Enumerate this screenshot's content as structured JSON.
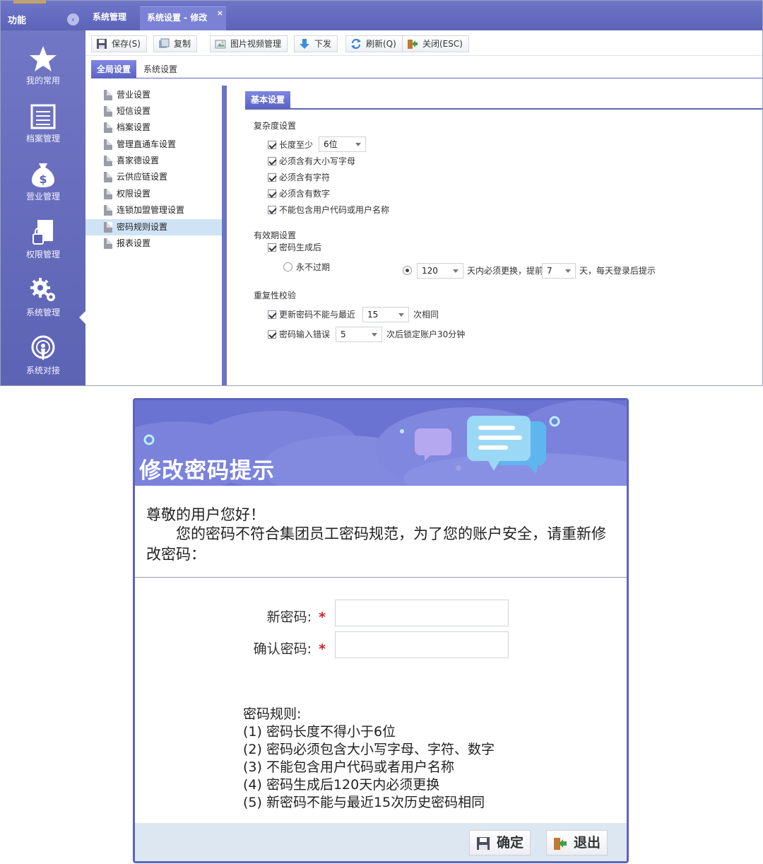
{
  "app": {
    "function_label": "功能",
    "tabs": [
      {
        "label": "系统管理"
      },
      {
        "label": "系统设置 - 修改"
      }
    ],
    "tab_close": "×",
    "nav": [
      {
        "label": "我的常用",
        "icon": "star-icon"
      },
      {
        "label": "档案管理",
        "icon": "file-list-icon"
      },
      {
        "label": "营业管理",
        "icon": "money-bag-icon"
      },
      {
        "label": "权限管理",
        "icon": "lock-document-icon"
      },
      {
        "label": "系统管理",
        "icon": "gears-icon"
      },
      {
        "label": "系统对接",
        "icon": "connection-icon"
      }
    ],
    "toolbar": [
      {
        "label": "保存(S)",
        "icon": "save-icon"
      },
      {
        "label": "复制",
        "icon": "copy-icon"
      },
      {
        "label": "图片视频管理",
        "icon": "media-icon"
      },
      {
        "label": "下发",
        "icon": "download-arrow-icon"
      },
      {
        "label": "刷新(Q)",
        "icon": "refresh-icon"
      },
      {
        "label": "关闭(ESC)",
        "icon": "exit-icon"
      }
    ],
    "subtabs": {
      "active": "全局设置",
      "other": "系统设置"
    },
    "tree": [
      "营业设置",
      "短信设置",
      "档案设置",
      "管理直通车设置",
      "喜家德设置",
      "云供应链设置",
      "权限设置",
      "连锁加盟管理设置",
      "密码规则设置",
      "报表设置"
    ],
    "tree_selected_index": 8,
    "section_title": "基本设置",
    "complexity": {
      "title": "复杂度设置",
      "min_length_label": "长度至少",
      "min_length_value": "6位",
      "items": [
        "必须含有大小写字母",
        "必须含有字符",
        "必须含有数字",
        "不能包含用户代码或用户名称"
      ]
    },
    "validity": {
      "title": "有效期设置",
      "after_generation_label": "密码生成后",
      "never_expire_label": "永不过期",
      "days_value": "120",
      "days_text": "天内必须更换，提前",
      "advance_value": "7",
      "advance_text": "天，每天登录后提示"
    },
    "repeat": {
      "title": "重复性校验",
      "history_label": "更新密码不能与最近",
      "history_value": "15",
      "history_suffix": "次相同",
      "lock_label": "密码输入错误",
      "lock_value": "5",
      "lock_suffix": "次后锁定账户30分钟"
    }
  },
  "dialog": {
    "title": "修改密码提示",
    "greeting": "尊敬的用户您好！",
    "message": "您的密码不符合集团员工密码规范，为了您的账户安全，请重新修改密码：",
    "new_password_label": "新密码:",
    "confirm_password_label": "确认密码:",
    "required_mark": "*",
    "rules_title": "密码规则:",
    "rules": [
      "(1) 密码长度不得小于6位",
      "(2) 密码必须包含大小写字母、字符、数字",
      "(3) 不能包含用户代码或者用户名称",
      "(4) 密码生成后120天内必须更换",
      "(5) 新密码不能与最近15次历史密码相同"
    ],
    "confirm_button": "确定",
    "exit_button": "退出"
  },
  "colors": {
    "brand": "#5d64b8",
    "banner": "#6a72d2",
    "selected_row": "#cfe3f5",
    "required": "#d0202a"
  }
}
